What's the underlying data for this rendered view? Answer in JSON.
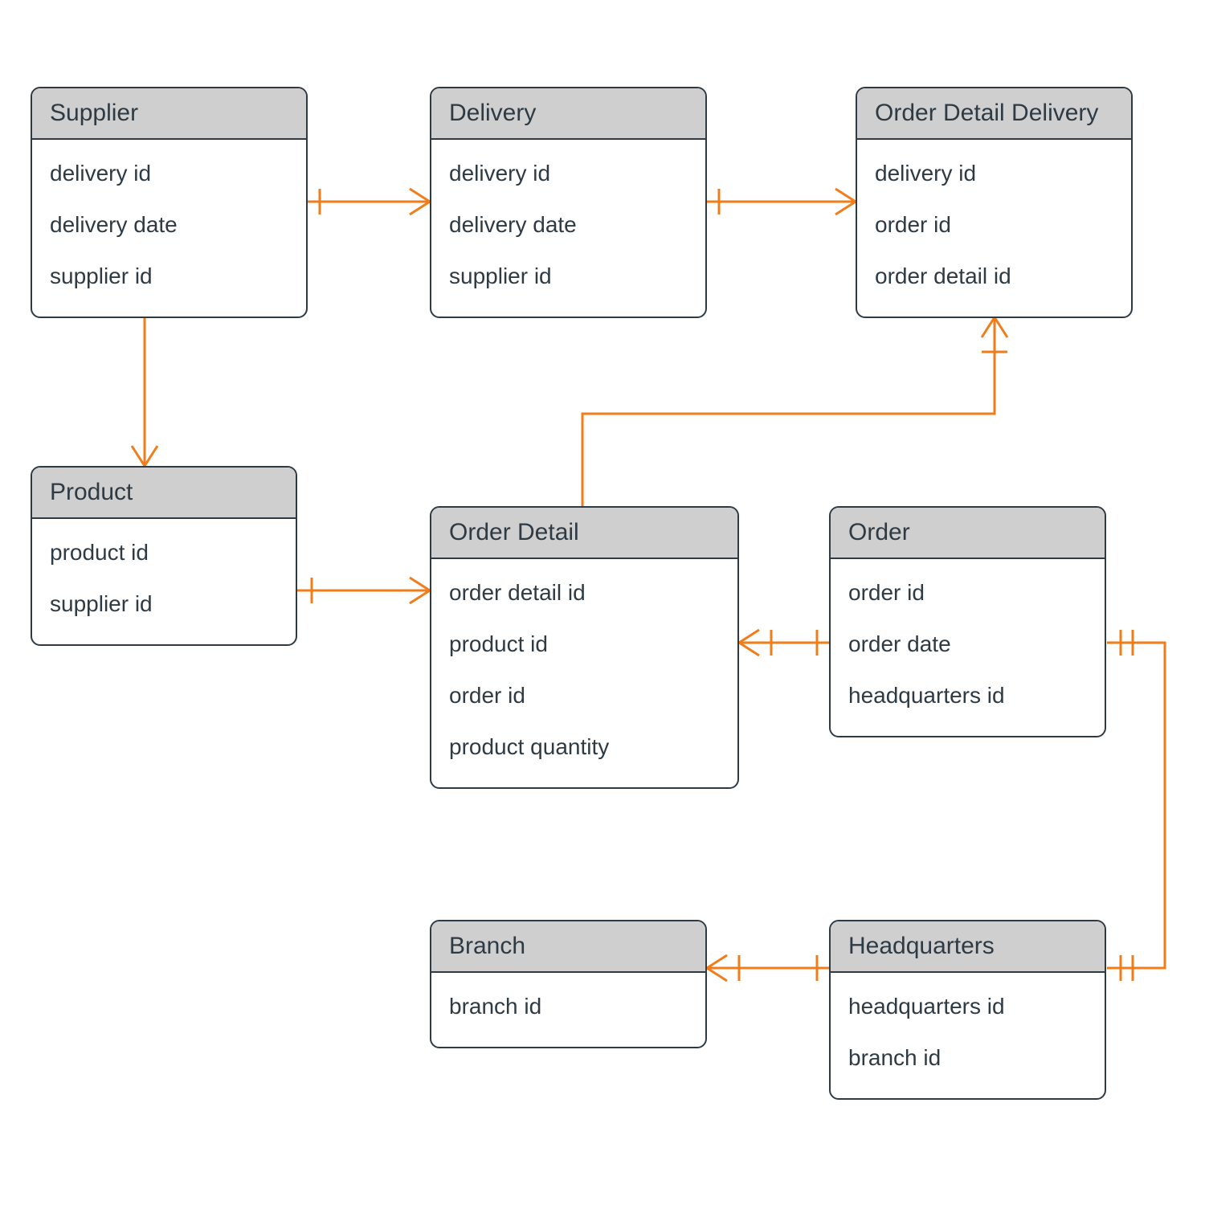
{
  "entities": {
    "supplier": {
      "title": "Supplier",
      "attrs": [
        "delivery id",
        "delivery date",
        "supplier id"
      ]
    },
    "delivery": {
      "title": "Delivery",
      "attrs": [
        "delivery id",
        "delivery date",
        "supplier id"
      ]
    },
    "order_detail_delivery": {
      "title": "Order Detail Delivery",
      "attrs": [
        "delivery id",
        "order id",
        "order detail id"
      ]
    },
    "product": {
      "title": "Product",
      "attrs": [
        "product id",
        "supplier id"
      ]
    },
    "order_detail": {
      "title": "Order Detail",
      "attrs": [
        "order detail id",
        "product id",
        "order id",
        "product quantity"
      ]
    },
    "order": {
      "title": "Order",
      "attrs": [
        "order id",
        "order date",
        "headquarters id"
      ]
    },
    "branch": {
      "title": "Branch",
      "attrs": [
        "branch id"
      ]
    },
    "headquarters": {
      "title": "Headquarters",
      "attrs": [
        "headquarters id",
        "branch id"
      ]
    }
  },
  "relationships": [
    {
      "from": "supplier",
      "to": "delivery",
      "type": "one-to-many"
    },
    {
      "from": "delivery",
      "to": "order_detail_delivery",
      "type": "one-to-many"
    },
    {
      "from": "supplier",
      "to": "product",
      "type": "one-to-many"
    },
    {
      "from": "product",
      "to": "order_detail",
      "type": "one-to-many"
    },
    {
      "from": "order_detail",
      "to": "order_detail_delivery",
      "type": "many-to-one"
    },
    {
      "from": "order",
      "to": "order_detail",
      "type": "one-to-many"
    },
    {
      "from": "headquarters",
      "to": "order",
      "type": "one-to-one"
    },
    {
      "from": "headquarters",
      "to": "branch",
      "type": "one-to-many"
    }
  ],
  "colors": {
    "line": "#f07d1a",
    "border": "#2e3a44",
    "header": "#cfcfcf"
  }
}
